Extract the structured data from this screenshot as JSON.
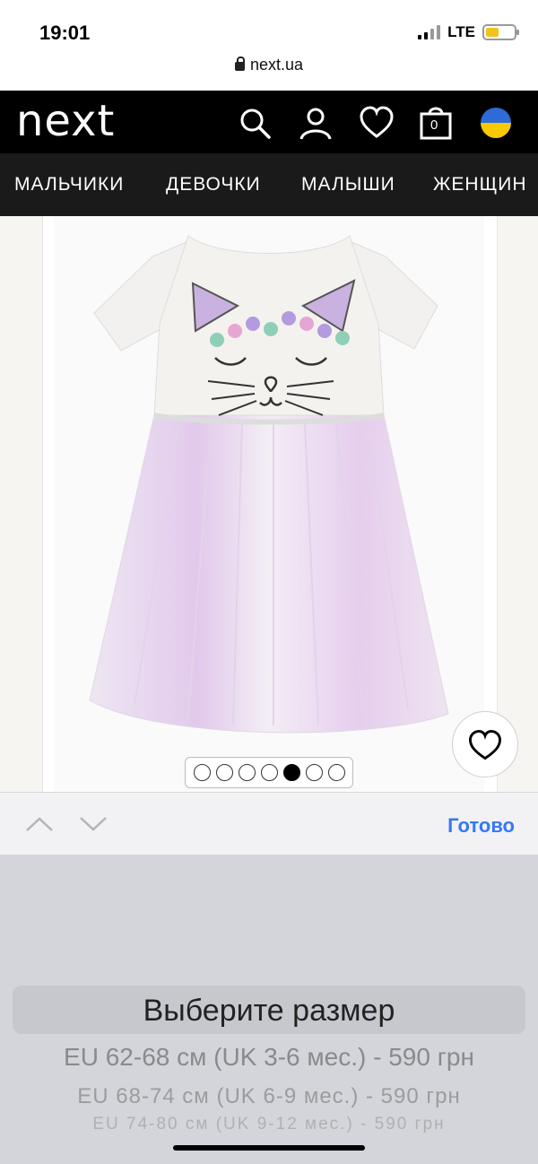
{
  "status_bar": {
    "time": "19:01",
    "network": "LTE"
  },
  "browser": {
    "url": "next.ua"
  },
  "header": {
    "logo": "next",
    "icons": [
      "search-icon",
      "user-icon",
      "heart-icon",
      "bag-icon",
      "flag-ukraine-icon"
    ],
    "bag_count": "0"
  },
  "nav": {
    "items": [
      "МАЛЬЧИКИ",
      "ДЕВОЧКИ",
      "МАЛЫШИ",
      "ЖЕНЩИН"
    ]
  },
  "gallery": {
    "total_images": 7,
    "active_index": 4
  },
  "toolbar": {
    "done_label": "Готово"
  },
  "size_picker": {
    "selected": "Выберите размер",
    "options": [
      "EU 62-68 см (UK 3-6 мес.) - 590 грн",
      "EU 68-74 см (UK 6-9 мес.) - 590 грн",
      "EU 74-80 см (UK 9-12 мес.) - 590 грн"
    ]
  },
  "colors": {
    "accent": "#3478f6",
    "header_bg": "#000000",
    "nav_bg": "#1a1a1a"
  }
}
